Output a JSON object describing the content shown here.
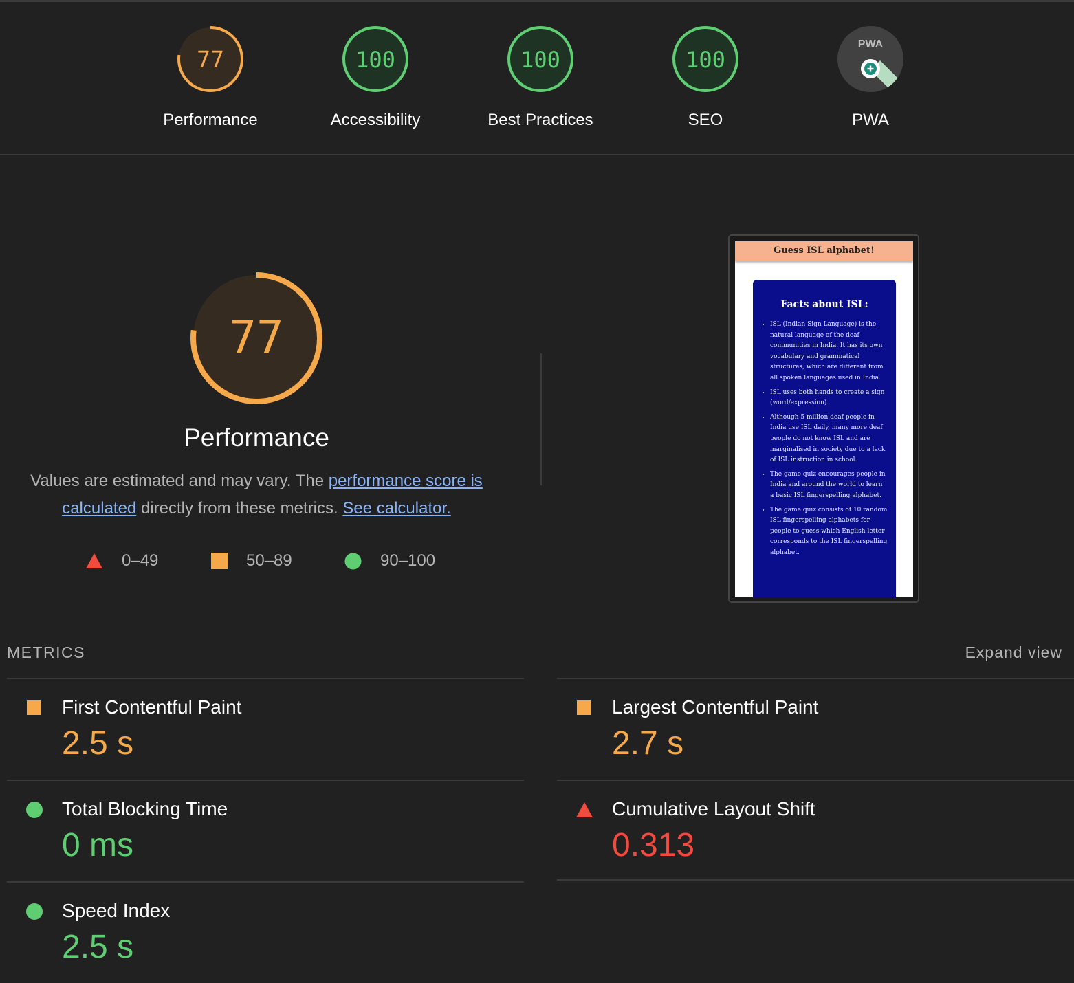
{
  "categories": [
    {
      "label": "Performance",
      "score": "77",
      "rating": "average"
    },
    {
      "label": "Accessibility",
      "score": "100",
      "rating": "pass"
    },
    {
      "label": "Best Practices",
      "score": "100",
      "rating": "pass"
    },
    {
      "label": "SEO",
      "score": "100",
      "rating": "pass"
    },
    {
      "label": "PWA",
      "badge": "PWA",
      "icon": "pwa-badge-icon"
    }
  ],
  "performance": {
    "score": "77",
    "score_fraction": 0.77,
    "title": "Performance",
    "description_prefix": "Values are estimated and may vary. The ",
    "description_link1": "performance score is calculated",
    "description_middle": " directly from these metrics. ",
    "description_link2": "See calculator."
  },
  "legend": {
    "fail": {
      "label": "0–49",
      "icon": "red-triangle-icon"
    },
    "average": {
      "label": "50–89",
      "icon": "orange-square-icon"
    },
    "pass": {
      "label": "90–100",
      "icon": "green-circle-icon"
    }
  },
  "screenshot": {
    "header": "Guess ISL alphabet!",
    "card_title": "Facts about ISL:",
    "facts": [
      "ISL (Indian Sign Language) is the natural language of the deaf communities in India. It has its own vocabulary and grammatical structures, which are different from all spoken languages used in India.",
      "ISL uses both hands to create a sign (word/expression).",
      "Although 5 million deaf people in India use ISL daily, many more deaf people do not know ISL and are marginalised in society due to a lack of ISL instruction in school.",
      "The game quiz encourages people in India and around the world to learn a basic ISL fingerspelling alphabet.",
      "The game quiz consists of 10 random ISL fingerspelling alphabets for people to guess which English letter corresponds to the ISL fingerspelling alphabet."
    ]
  },
  "metrics_section": {
    "header": "METRICS",
    "expand_label": "Expand view"
  },
  "metrics": [
    {
      "title": "First Contentful Paint",
      "value": "2.5 s",
      "rating": "average"
    },
    {
      "title": "Largest Contentful Paint",
      "value": "2.7 s",
      "rating": "average"
    },
    {
      "title": "Total Blocking Time",
      "value": "0 ms",
      "rating": "pass"
    },
    {
      "title": "Cumulative Layout Shift",
      "value": "0.313",
      "rating": "fail"
    },
    {
      "title": "Speed Index",
      "value": "2.5 s",
      "rating": "pass"
    }
  ],
  "colors": {
    "background": "#212121",
    "pass": "#5fce73",
    "average": "#f5a94a",
    "fail": "#f04b3f",
    "link": "#8ab4f8"
  }
}
